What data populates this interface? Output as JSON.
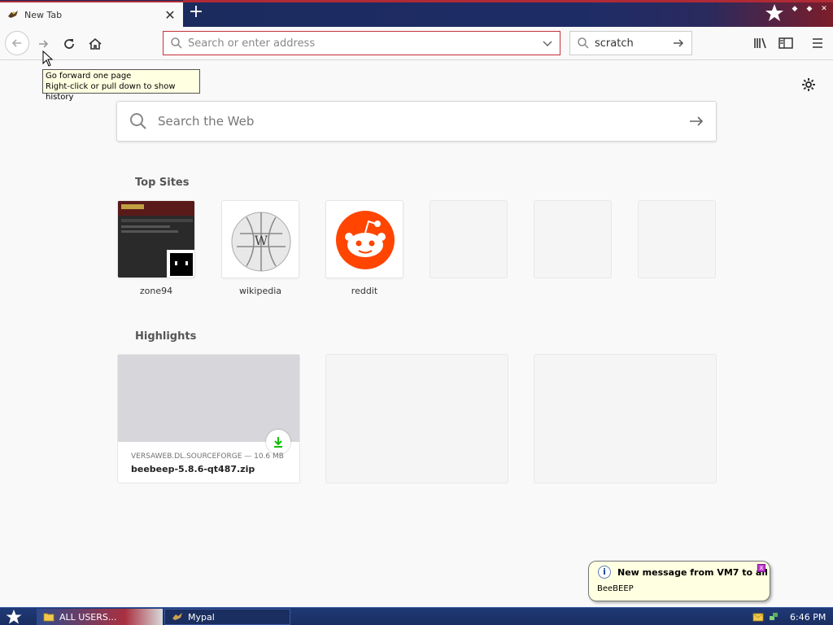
{
  "tab": {
    "title": "New Tab"
  },
  "urlbar": {
    "placeholder": "Search or enter address"
  },
  "searchbar": {
    "value": "scratch"
  },
  "tooltip": {
    "line1": "Go forward one page",
    "line2": "Right-click or pull down to show history"
  },
  "websearch": {
    "placeholder": "Search the Web"
  },
  "top_sites": {
    "title": "Top Sites",
    "items": [
      {
        "label": "zone94"
      },
      {
        "label": "wikipedia"
      },
      {
        "label": "reddit"
      },
      {
        "label": ""
      },
      {
        "label": ""
      },
      {
        "label": ""
      }
    ]
  },
  "highlights": {
    "title": "Highlights",
    "items": [
      {
        "source": "VERSAWEB.DL.SOURCEFORGE — 10.6 MB",
        "name": "beebeep-5.8.6-qt487.zip"
      }
    ]
  },
  "notification": {
    "title": "New message from VM7 to all",
    "body": "BeeBEEP"
  },
  "taskbar": {
    "task1": "ALL USERS...",
    "task2": "Mypal",
    "clock": "6:46 PM"
  },
  "colors": {
    "accent_red": "#b02a36",
    "taskbar_blue": "#1a2e5f",
    "reddit": "#ff4500",
    "download_green": "#12bc00"
  }
}
